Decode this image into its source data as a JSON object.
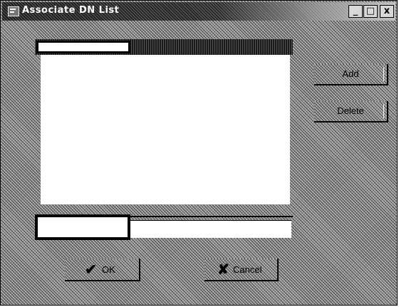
{
  "window": {
    "title": "Associate DN List",
    "controls": {
      "minimize": "_",
      "maximize": "□",
      "close": "x"
    }
  },
  "list": {
    "header_value": "",
    "items": [],
    "entry_value": ""
  },
  "buttons": {
    "add_label": "Add",
    "delete_label": "Delete",
    "ok_label": "OK",
    "cancel_label": "Cancel",
    "ok_icon": "✔",
    "cancel_icon": "✘"
  }
}
